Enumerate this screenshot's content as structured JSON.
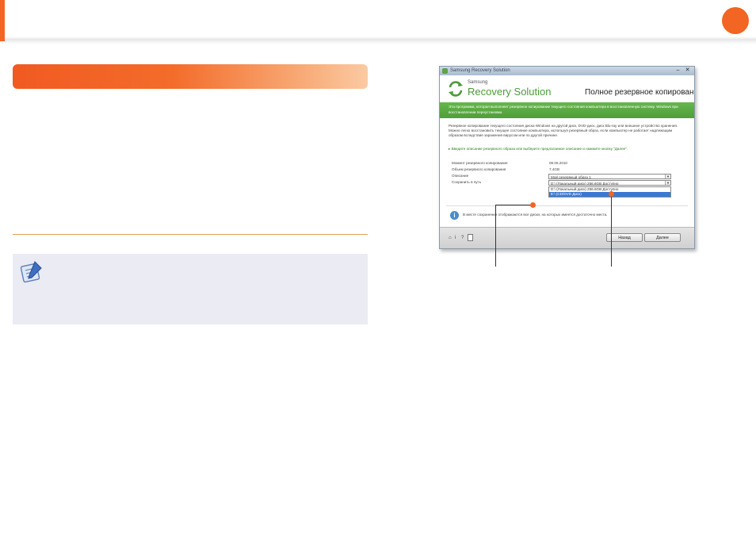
{
  "colors": {
    "accent": "#f26522",
    "brand_green": "#4c9a3a",
    "selection": "#3a78d6"
  },
  "window": {
    "title": "Samsung Recovery Solution",
    "brand_small": "Samsung",
    "brand_large": "Recovery Solution",
    "header_title": "Полное резервное копирование",
    "green_bar_text": "Эта программа, которая выполняет резервное копирование текущего состояния компьютера в восстановленную систему. Windows при восстановлении переустановки.",
    "description": "Резервное копирование текущего состояния диска Windows на другой диск, DVD-диск, диск Blu-ray или внешнее устройство хранения. Можно легко восстановить текущее состояние компьютера, используя резервный образ, если компьютер не работает надлежащим образом вследствие заражения вирусом или по другой причине.",
    "hint": "▸ Введите описание резервного образа или выберите предлагаемое описание и нажмите кнопку \"Далее\".",
    "rows": [
      {
        "label": "Момент резервного копирования",
        "value": "09.06.2010"
      },
      {
        "label": "Объем резервного копирования",
        "value": "7.4GB"
      },
      {
        "label": "Описание",
        "value": "Мой резервный образ 1"
      },
      {
        "label": "Сохранить в путь",
        "value": "D:\\ (Локальный диск) 256.6GB Доступно"
      }
    ],
    "dropdown_options": [
      {
        "label": "D:\\ (Локальный диск) 256.6GB Доступно",
        "selected": false
      },
      {
        "label": "E:\\ (CD/DVD Диск)",
        "selected": true
      }
    ],
    "info_text": "В месте сохранения отображаются все диски, на которых имеется достаточно места.",
    "footer": {
      "back_label": "Назад",
      "done_label": "Далее"
    }
  }
}
